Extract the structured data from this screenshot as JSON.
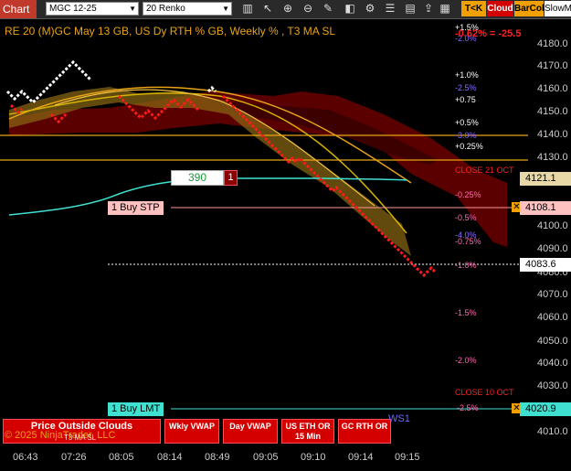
{
  "toolbar": {
    "chart_tab": "Chart",
    "instrument": "MGC 12-25",
    "bar_type": "20 Renko",
    "toggle_tk": "T<K",
    "toggle_cloud": "Cloud",
    "toggle_barcol": "BarCol",
    "toggle_slow": "SlowM"
  },
  "header": {
    "title": "RE 20  (M)GC May 13 GB, US Dy RTH % GB, Weekly % , T3 MA SL",
    "pct_top": "+1.5%",
    "pct_top2": "-2.0%",
    "pct_diff": "-0.62% = -25.5"
  },
  "y_axis": {
    "ticks": [
      "4180.0",
      "4170.0",
      "4160.0",
      "4150.0",
      "4140.0",
      "4130.0",
      "4120.0",
      "4110.0",
      "4100.0",
      "4090.0",
      "4080.0",
      "4070.0",
      "4060.0",
      "4050.0",
      "4040.0",
      "4030.0",
      "4020.0",
      "4010.0"
    ],
    "price_current": "4121.1",
    "price_buy_stp": "4108.1",
    "price_cursor": "4083.6",
    "price_buy_lmt": "4020.9"
  },
  "x_axis": {
    "ticks": [
      "06:43",
      "07:26",
      "08:05",
      "08:14",
      "08:49",
      "09:05",
      "09:10",
      "09:14",
      "09:15"
    ]
  },
  "pct_levels": {
    "p1": "+1.0%",
    "p2": "-2.5%",
    "p3": "+0.75",
    "p4": "+0.5%",
    "p5": "-3.0%",
    "p6": "+0.25%",
    "p7": "-0.25%",
    "p8": "-0.5%",
    "p9": "-4.0%",
    "p10": "-0.75%",
    "p11": "-1.0%",
    "p12": "-1.5%",
    "p13": "-2.0%",
    "p14": "-2.5%"
  },
  "labels": {
    "close21": "CLOSE 21 OCT",
    "close10": "CLOSE 10 OCT",
    "ws1": "WS1",
    "copyright": "© 2025 NinjaTrader, LLC",
    "t3": "T3 MA SL"
  },
  "orders": {
    "qty_box": "390",
    "qty_count": "1",
    "buy_stp": "1 Buy STP",
    "buy_lmt": "1 Buy LMT"
  },
  "buttons": {
    "price_outside": "Price Outside Clouds",
    "wkly_vwap": "Wkly VWAP",
    "day_vwap": "Day VWAP",
    "us_eth": "US ETH OR 15 Min",
    "gc_rth": "GC RTH OR"
  },
  "colors": {
    "accent": "#c0392b",
    "cloud_red": "#8b0000",
    "cloud_gold": "#b8860b",
    "cyan": "#40e0d0",
    "orange_line": "#e8a317"
  }
}
